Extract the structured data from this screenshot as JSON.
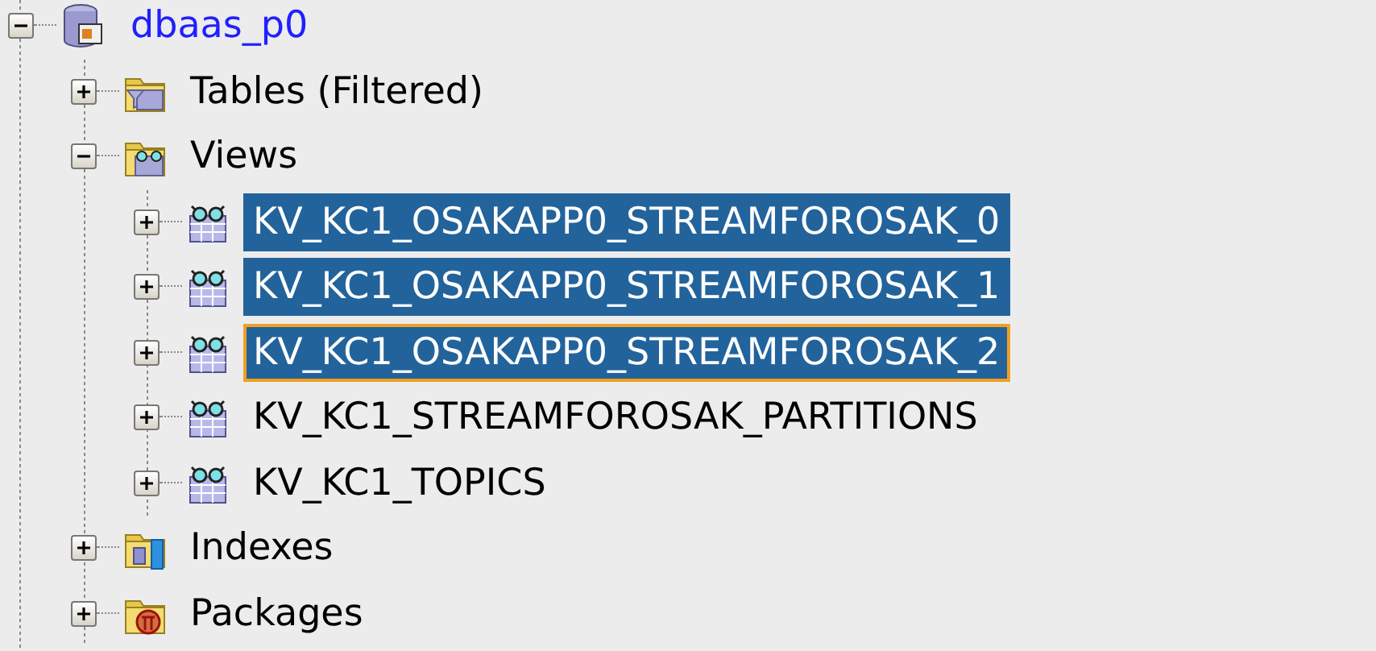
{
  "tree": {
    "label": "dbaas_p0",
    "kind": "database",
    "expanded": true,
    "selected": false,
    "focused": false,
    "children": [
      {
        "label": "Tables (Filtered)",
        "kind": "tables-folder",
        "expanded": false,
        "selected": false,
        "focused": false
      },
      {
        "label": "Views",
        "kind": "views-folder",
        "expanded": true,
        "selected": false,
        "focused": false,
        "children": [
          {
            "label": "KV_KC1_OSAKAPP0_STREAMFOROSAK_0",
            "kind": "view",
            "expanded": false,
            "selected": true,
            "focused": false
          },
          {
            "label": "KV_KC1_OSAKAPP0_STREAMFOROSAK_1",
            "kind": "view",
            "expanded": false,
            "selected": true,
            "focused": false
          },
          {
            "label": "KV_KC1_OSAKAPP0_STREAMFOROSAK_2",
            "kind": "view",
            "expanded": false,
            "selected": true,
            "focused": true
          },
          {
            "label": "KV_KC1_STREAMFOROSAK_PARTITIONS",
            "kind": "view",
            "expanded": false,
            "selected": false,
            "focused": false
          },
          {
            "label": "KV_KC1_TOPICS",
            "kind": "view",
            "expanded": false,
            "selected": false,
            "focused": false
          }
        ]
      },
      {
        "label": "Indexes",
        "kind": "indexes-folder",
        "expanded": false,
        "selected": false,
        "focused": false
      },
      {
        "label": "Packages",
        "kind": "packages-folder",
        "expanded": false,
        "selected": false,
        "focused": false
      }
    ]
  }
}
